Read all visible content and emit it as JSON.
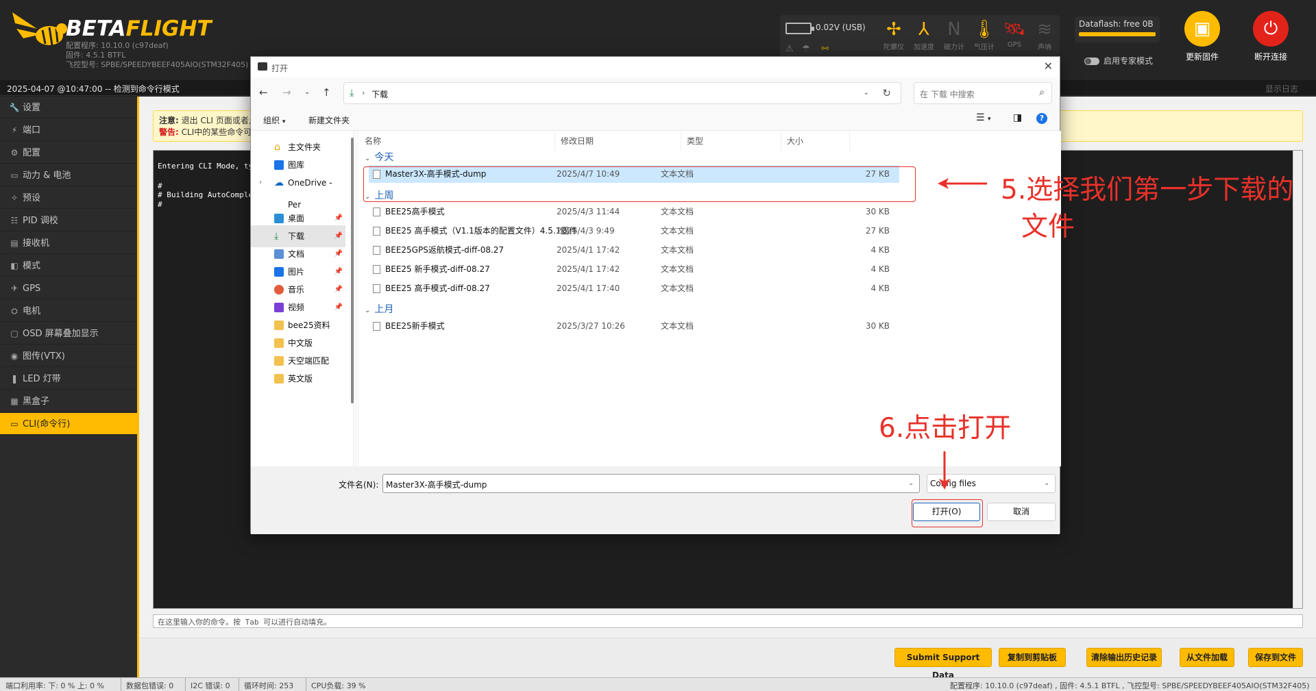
{
  "header": {
    "logo_prefix": "BETA",
    "logo_suffix": "FLIGHT",
    "config_line": "配置程序: 10.10.0 (c97deaf)",
    "firmware_line": "固件: 4.5.1 BTFL",
    "board_line": "飞控型号: SPBE/SPEEDYBEEF405AIO(STM32F405)",
    "battery_value": "0.02V (USB)",
    "sensors": [
      {
        "label": "陀螺仪",
        "icon": "gyro-icon"
      },
      {
        "label": "加速度",
        "icon": "accelerometer-icon"
      },
      {
        "label": "磁力计",
        "icon": "magnetometer-icon"
      },
      {
        "label": "气压计",
        "icon": "barometer-icon"
      },
      {
        "label": "GPS",
        "icon": "gps-icon"
      },
      {
        "label": "声纳",
        "icon": "sonar-icon"
      }
    ],
    "dataflash_label": "Dataflash: free 0B",
    "expert_mode_label": "启用专家模式",
    "update_firmware_label": "更新固件",
    "disconnect_label": "断开连接",
    "colors": {
      "accent": "#ffbb00",
      "disconnect": "#e2231a",
      "annotation": "#e8312a"
    }
  },
  "statusbar": {
    "text": "2025-04-07 @10:47:00 -- 检测到命令行模式",
    "show_log": "显示日志"
  },
  "sidebar": {
    "items": [
      {
        "label": "设置",
        "icon": "wrench-icon"
      },
      {
        "label": "端口",
        "icon": "plug-icon"
      },
      {
        "label": "配置",
        "icon": "gear-icon"
      },
      {
        "label": "动力 & 电池",
        "icon": "battery-icon"
      },
      {
        "label": "预设",
        "icon": "magic-icon"
      },
      {
        "label": "PID 调校",
        "icon": "sliders-icon"
      },
      {
        "label": "接收机",
        "icon": "receiver-icon"
      },
      {
        "label": "模式",
        "icon": "toggle-icon"
      },
      {
        "label": "GPS",
        "icon": "satellite-icon"
      },
      {
        "label": "电机",
        "icon": "motor-icon"
      },
      {
        "label": "OSD 屏幕叠加显示",
        "icon": "osd-icon"
      },
      {
        "label": "图传(VTX)",
        "icon": "antenna-icon"
      },
      {
        "label": "LED 灯带",
        "icon": "bulb-icon"
      },
      {
        "label": "黑盒子",
        "icon": "blackbox-icon"
      },
      {
        "label": "CLI(命令行)",
        "icon": "terminal-icon"
      }
    ]
  },
  "notice": {
    "note_label": "注意:",
    "note_text": "退出 CLI 页面或者点",
    "warn_label": "警告:",
    "warn_text": "CLI中的某些命令可"
  },
  "cli": {
    "lines": [
      "Entering CLI Mode, type",
      "#",
      "# Building AutoComplete",
      "#"
    ],
    "input_placeholder": "在这里输入你的命令。按 Tab 可以进行自动填充。"
  },
  "bottom_buttons": {
    "submit": "Submit Support Data",
    "copy": "复制到剪贴板",
    "clear": "清除输出历史记录",
    "load": "从文件加载",
    "save": "保存到文件"
  },
  "footer": {
    "port_usage": "端口利用率:  下: 0 % 上: 0 %",
    "packet_errors": "数据包错误: 0",
    "i2c_errors": "I2C 错误: 0",
    "cycle_time": "循环时间: 253",
    "cpu_load": "CPU负载: 39 %",
    "version_info": "配置程序: 10.10.0 (c97deaf) , 固件: 4.5.1 BTFL , 飞控型号: SPBE/SPEEDYBEEF405AIO(STM32F405)"
  },
  "dialog": {
    "title": "打开",
    "address": "下载",
    "search_placeholder": "在 下载 中搜索",
    "organize": "组织",
    "new_folder": "新建文件夹",
    "nav_items": [
      {
        "label": "主文件夹",
        "pinned": false
      },
      {
        "label": "图库",
        "pinned": false
      },
      {
        "label": "OneDrive - Per",
        "pinned": false
      },
      {
        "label": "桌面",
        "pinned": true
      },
      {
        "label": "下载",
        "pinned": true
      },
      {
        "label": "文档",
        "pinned": true
      },
      {
        "label": "图片",
        "pinned": true
      },
      {
        "label": "音乐",
        "pinned": true
      },
      {
        "label": "视频",
        "pinned": true
      },
      {
        "label": "bee25资料",
        "pinned": false
      },
      {
        "label": "中文版",
        "pinned": false
      },
      {
        "label": "天空端匹配",
        "pinned": false
      },
      {
        "label": "英文版",
        "pinned": false
      }
    ],
    "columns": {
      "name": "名称",
      "date": "修改日期",
      "type": "类型",
      "size": "大小"
    },
    "groups": [
      {
        "label": "今天",
        "files": [
          {
            "name": "Master3X-高手模式-dump",
            "date": "2025/4/7 10:49",
            "type": "文本文档",
            "size": "27 KB"
          }
        ]
      },
      {
        "label": "上周",
        "files": [
          {
            "name": "BEE25高手模式",
            "date": "2025/4/3 11:44",
            "type": "文本文档",
            "size": "30 KB"
          },
          {
            "name": "BEE25 高手模式（V1.1版本的配置文件）4.5.1固件",
            "date": "2025/4/3 9:49",
            "type": "文本文档",
            "size": "27 KB"
          },
          {
            "name": "BEE25GPS返航模式-diff-08.27",
            "date": "2025/4/1 17:42",
            "type": "文本文档",
            "size": "4 KB"
          },
          {
            "name": "BEE25 新手模式-diff-08.27",
            "date": "2025/4/1 17:42",
            "type": "文本文档",
            "size": "4 KB"
          },
          {
            "name": "BEE25 高手模式-diff-08.27",
            "date": "2025/4/1 17:40",
            "type": "文本文档",
            "size": "4 KB"
          }
        ]
      },
      {
        "label": "上月",
        "files": [
          {
            "name": "BEE25新手模式",
            "date": "2025/3/27 10:26",
            "type": "文本文档",
            "size": "30 KB"
          }
        ]
      }
    ],
    "filename_label": "文件名(N):",
    "filename_value": "Master3X-高手模式-dump",
    "filetype_value": "Config files",
    "open_label": "打开(O)",
    "cancel_label": "取消"
  },
  "annotations": {
    "step5_line1": "5.选择我们第一步下载的",
    "step5_line2": "文件",
    "step6": "6.点击打开"
  }
}
